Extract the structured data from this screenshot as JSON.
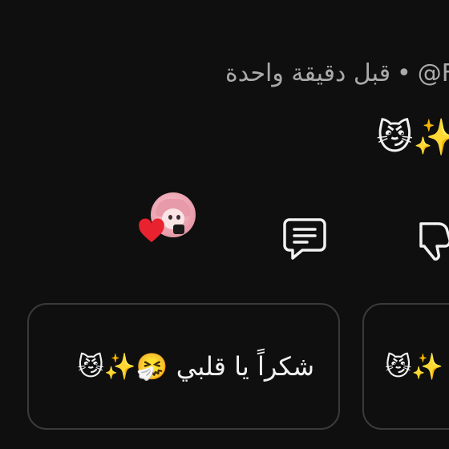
{
  "comment": {
    "handle_partial": "@F",
    "separator": "•",
    "timestamp": "قبل دقيقة واحدة",
    "emoji_text": "😼✨"
  },
  "actions": {
    "creator_heart_avatar": "creator-avatar",
    "reply_icon": "comment-icon",
    "dislike_icon": "thumbs-down-icon"
  },
  "suggestions": [
    {
      "text": "شكراً يا قلبي 🤧✨😼"
    },
    {
      "text": "😼✨"
    }
  ],
  "colors": {
    "background": "#0f0f0f",
    "text_secondary": "#aaaaaa",
    "text_primary": "#f1f1f1",
    "card_border": "#3a3a3a",
    "heart": "#e8222e"
  }
}
